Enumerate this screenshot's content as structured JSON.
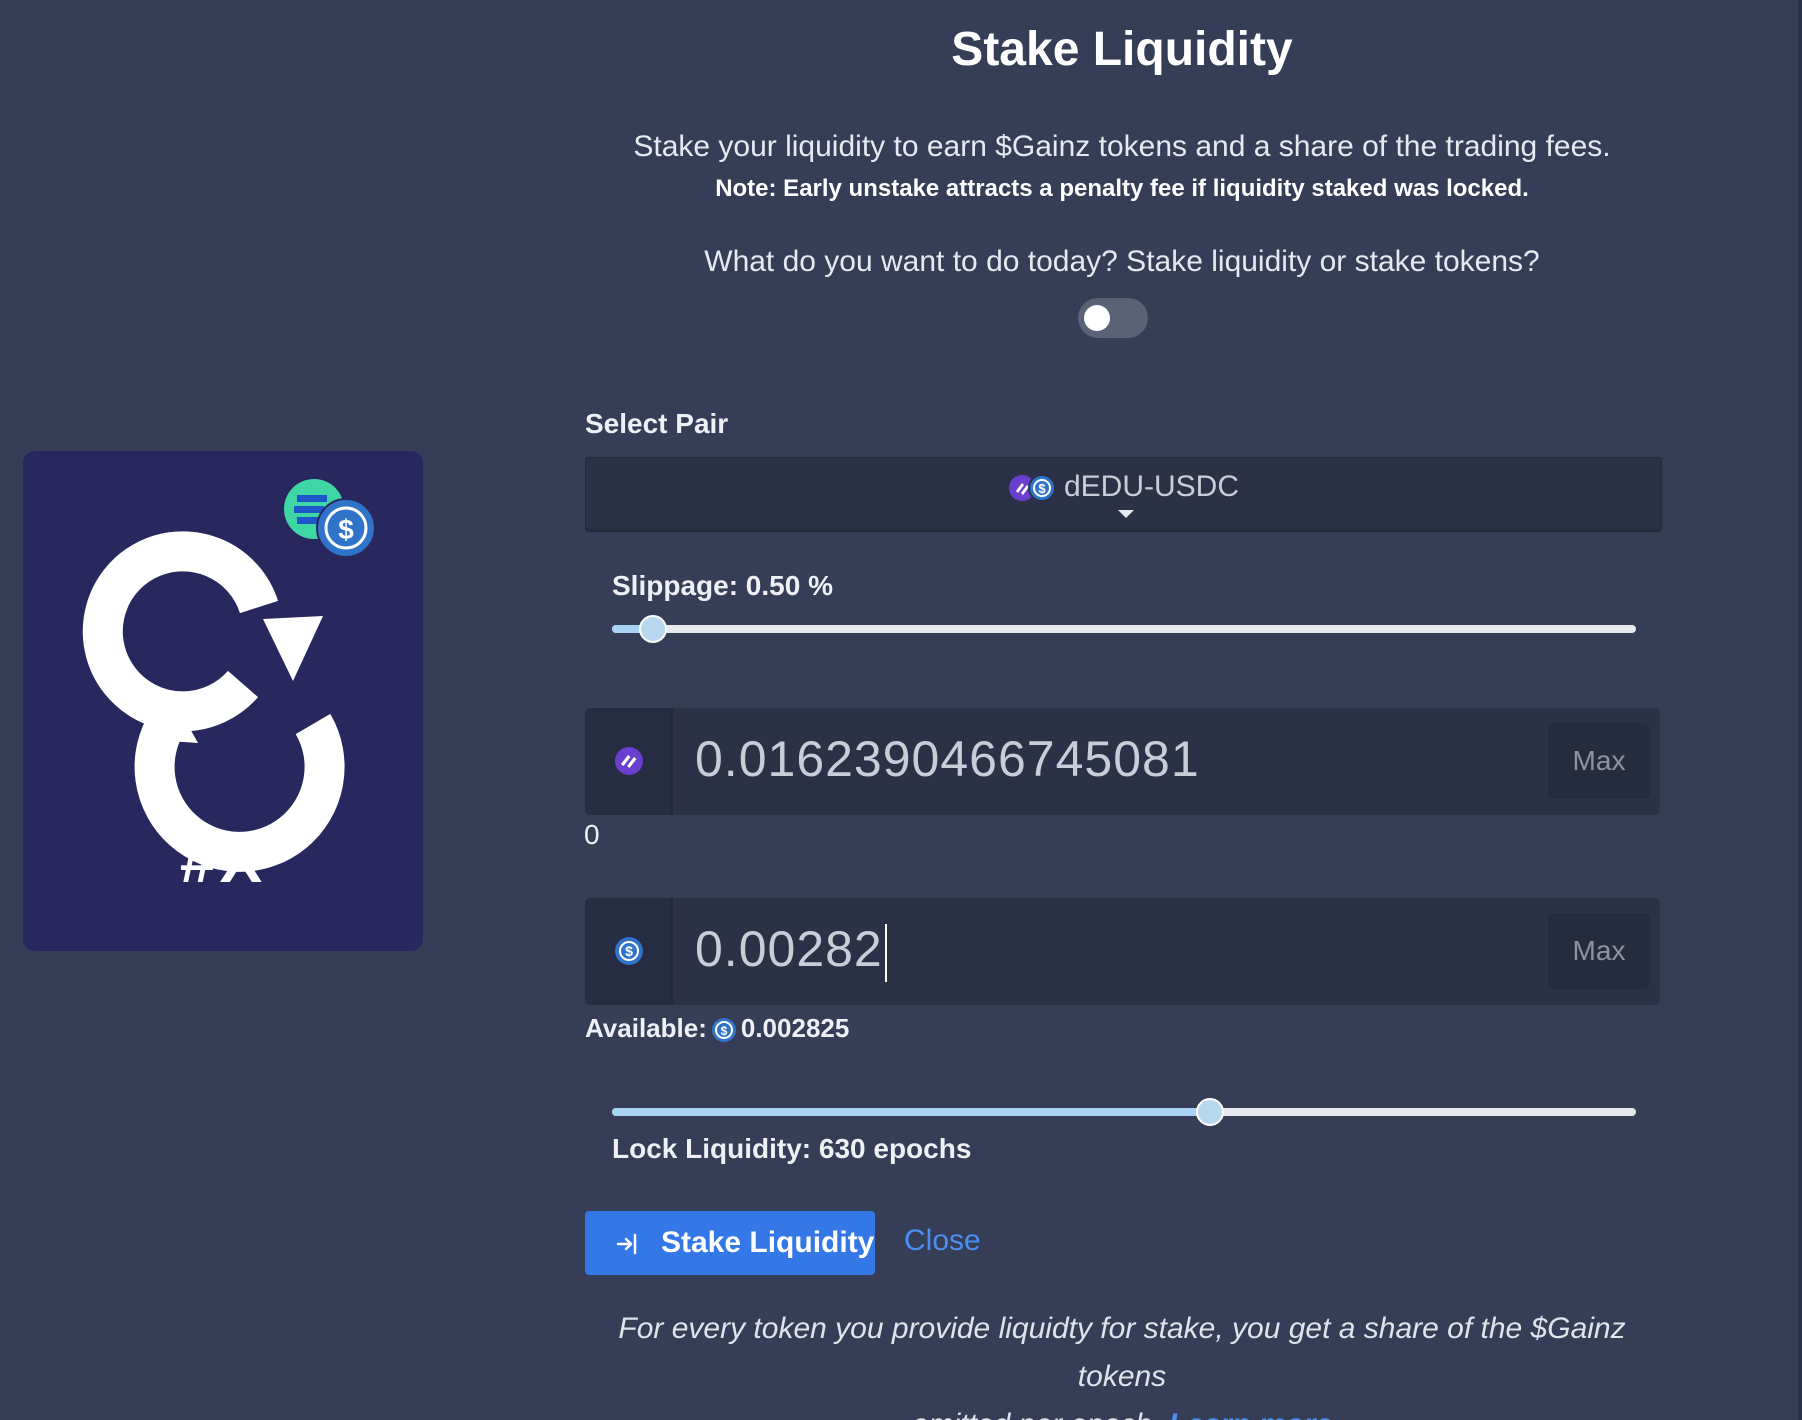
{
  "page": {
    "title": "Stake Liquidity",
    "subtitle": "Stake your liquidity to earn $Gainz tokens and a share of the trading fees.",
    "note": "Note: Early unstake attracts a penalty fee if liquidity staked was locked.",
    "question": "What do you want to do today? Stake liquidity or stake tokens?",
    "toggle_on": false
  },
  "logo": {
    "text": "#X"
  },
  "pair": {
    "label": "Select Pair",
    "selected": "dEDU-USDC"
  },
  "slippage": {
    "label": "Slippage: 0.50 %",
    "fraction": 0.04
  },
  "token_a": {
    "icon": "dedu-token-icon",
    "value": "0.0162390466745081",
    "max_label": "Max",
    "balance": "0"
  },
  "token_b": {
    "icon": "usdc-token-icon",
    "value": "0.00282",
    "max_label": "Max"
  },
  "available": {
    "label": "Available:",
    "value": "0.002825"
  },
  "lock": {
    "label": "Lock Liquidity: 630 epochs",
    "fraction": 0.584
  },
  "actions": {
    "stake_label": "Stake Liquidity",
    "close_label": "Close"
  },
  "footer": {
    "text_line1": "For every token you provide liquidty for stake, you get a share of the $Gainz tokens",
    "text_line2": "emitted per epoch.",
    "learn_more": "Learn more"
  },
  "colors": {
    "background": "#353d57",
    "accent": "#3477e6",
    "link": "#4b8fef",
    "logo_bg": "#28285e"
  }
}
